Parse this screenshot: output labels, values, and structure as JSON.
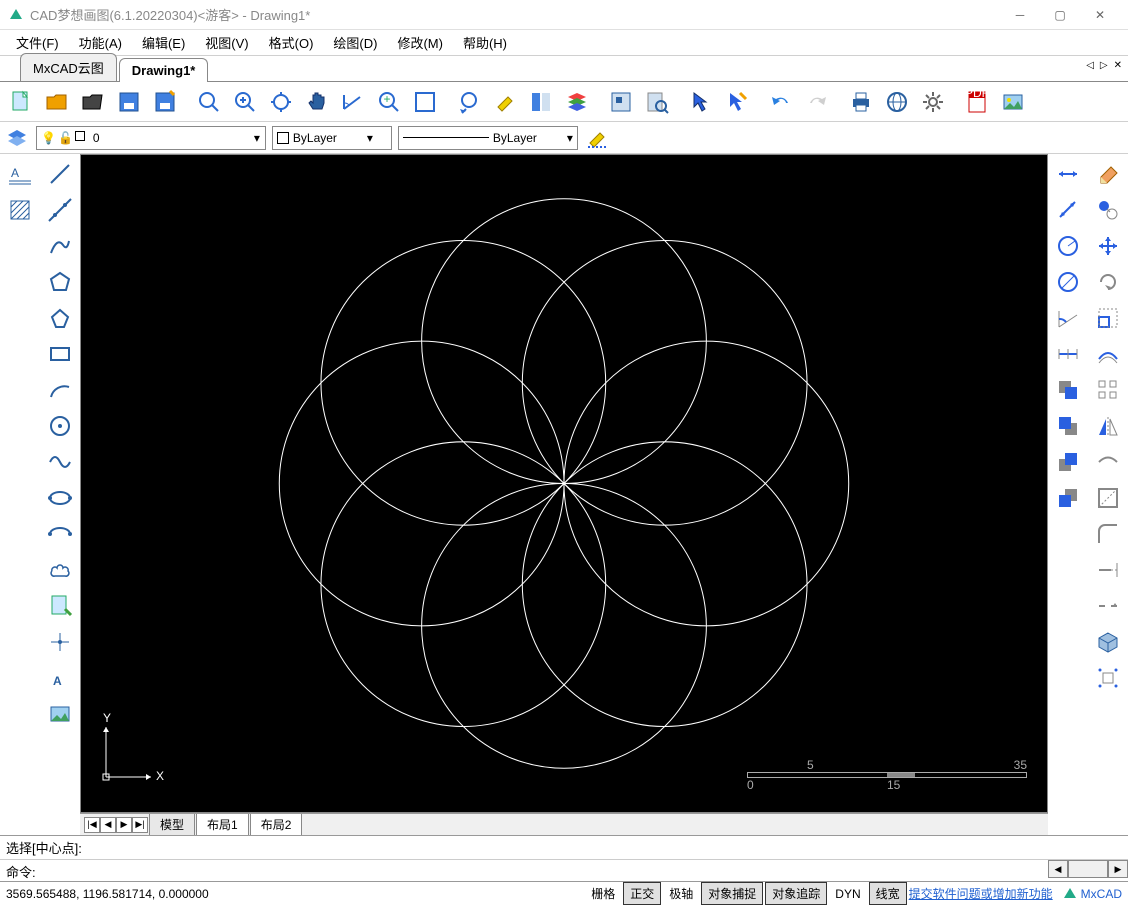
{
  "window": {
    "title": "CAD梦想画图(6.1.20220304)<游客> - Drawing1*"
  },
  "menu": {
    "file": "文件(F)",
    "func": "功能(A)",
    "edit": "编辑(E)",
    "view": "视图(V)",
    "format": "格式(O)",
    "draw": "绘图(D)",
    "modify": "修改(M)",
    "help": "帮助(H)"
  },
  "doctabs": {
    "t1": "MxCAD云图",
    "t2": "Drawing1*"
  },
  "props": {
    "layer_value": "0",
    "color_label": "ByLayer",
    "ltype_label": "ByLayer"
  },
  "bottomtabs": {
    "model": "模型",
    "layout1": "布局1",
    "layout2": "布局2"
  },
  "cmd": {
    "history": "选择[中心点]:",
    "prompt": "命令:"
  },
  "status": {
    "coords": "3569.565488,  1196.581714,  0.000000",
    "grid": "栅格",
    "ortho": "正交",
    "polar": "极轴",
    "osnap": "对象捕捉",
    "otrack": "对象追踪",
    "dyn": "DYN",
    "lwt": "线宽",
    "feedback": "提交软件问题或增加新功能",
    "brand": "MxCAD"
  },
  "scale": {
    "s1": "5",
    "s2": "35",
    "s3": "0",
    "s4": "15"
  }
}
